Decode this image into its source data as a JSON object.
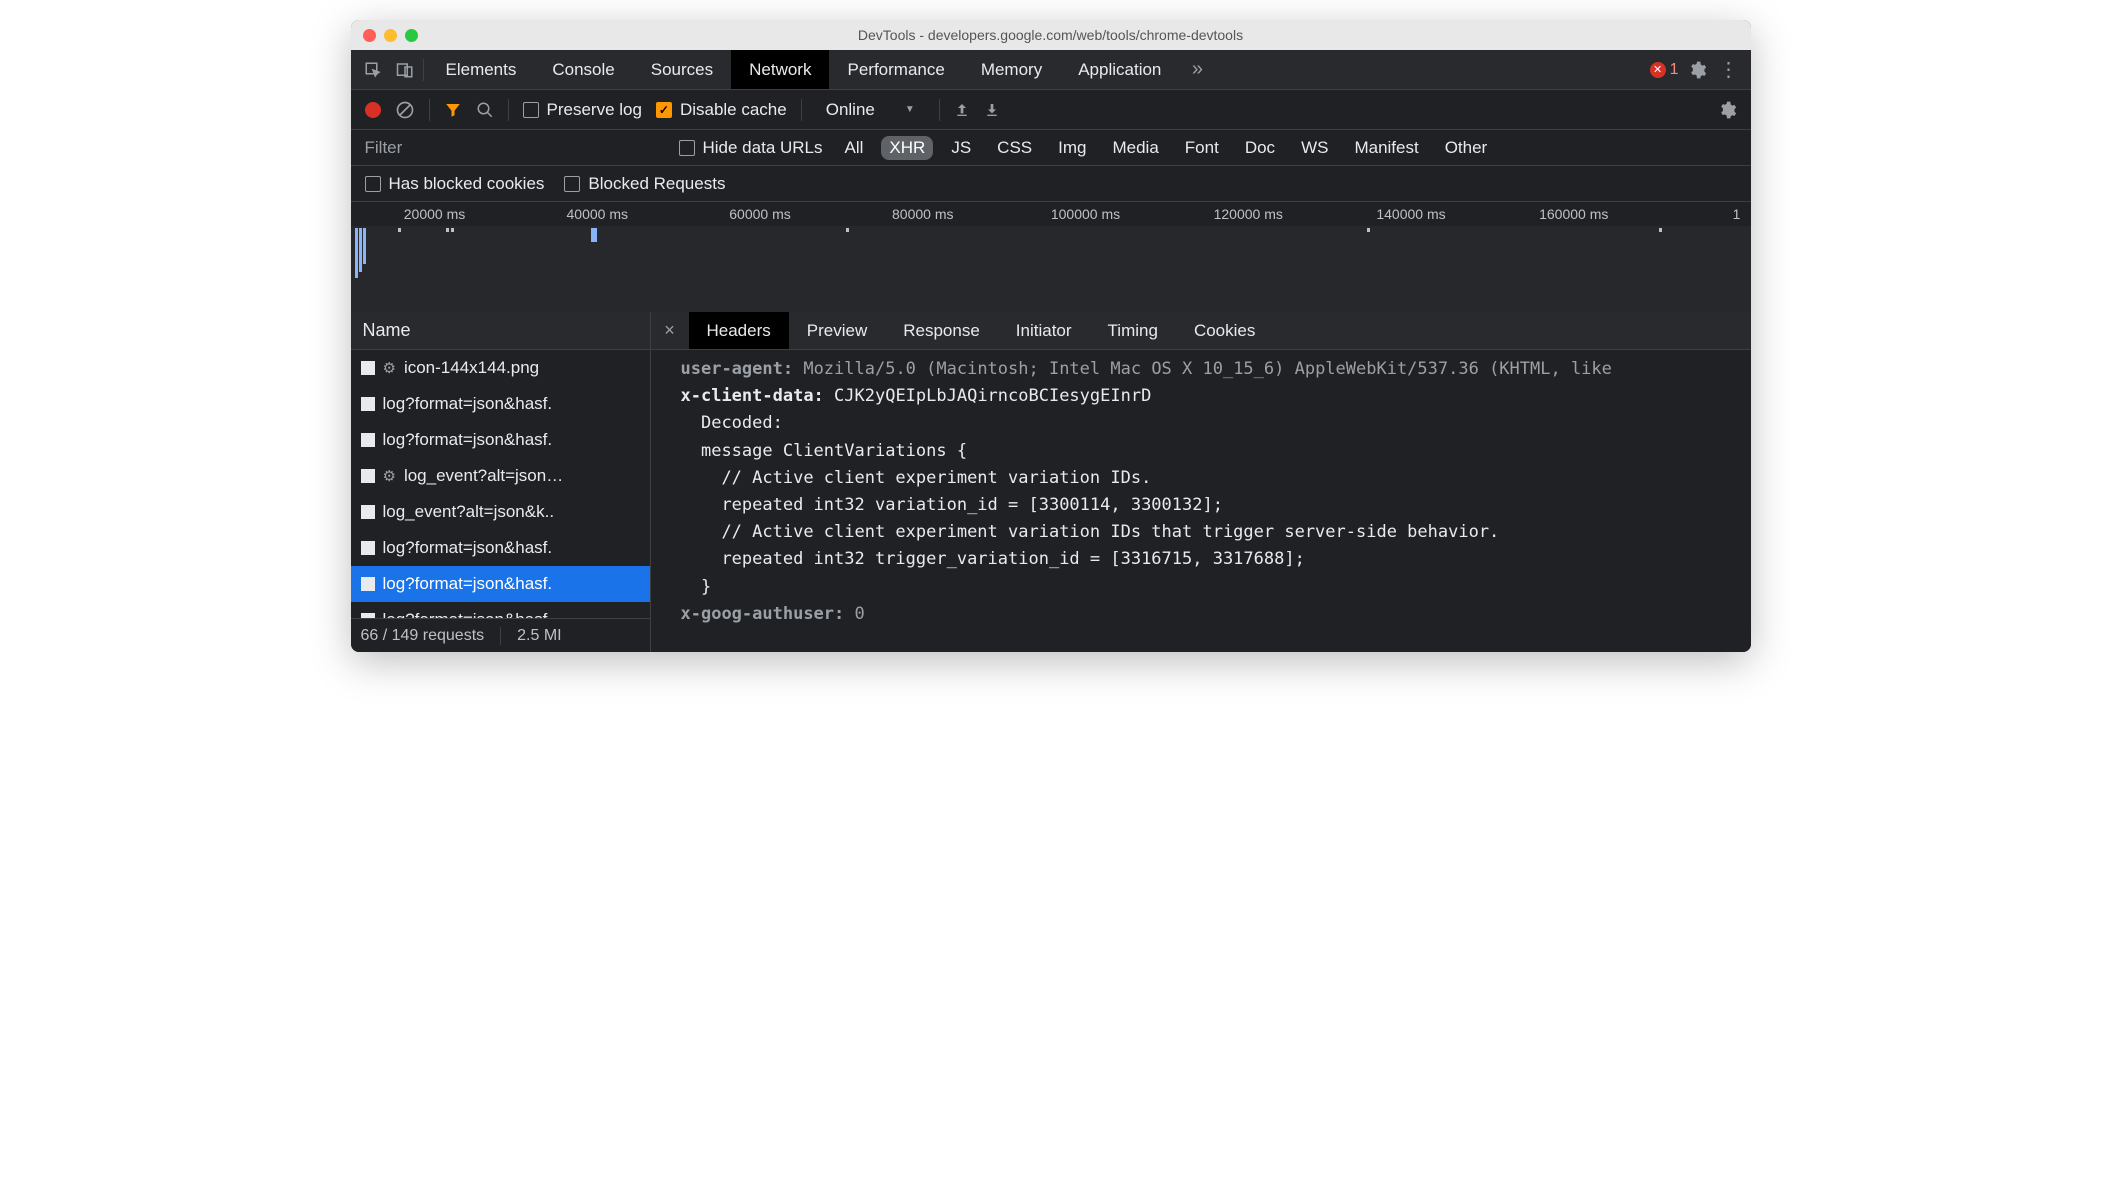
{
  "window": {
    "title": "DevTools - developers.google.com/web/tools/chrome-devtools"
  },
  "tabs": {
    "items": [
      "Elements",
      "Console",
      "Sources",
      "Network",
      "Performance",
      "Memory",
      "Application"
    ],
    "active": "Network",
    "error_count": "1"
  },
  "toolbar": {
    "preserve_log": "Preserve log",
    "disable_cache": "Disable cache",
    "throttling": "Online"
  },
  "filter": {
    "placeholder": "Filter",
    "hide_data_urls": "Hide data URLs",
    "types": [
      "All",
      "XHR",
      "JS",
      "CSS",
      "Img",
      "Media",
      "Font",
      "Doc",
      "WS",
      "Manifest",
      "Other"
    ],
    "active_type": "XHR",
    "has_blocked_cookies": "Has blocked cookies",
    "blocked_requests": "Blocked Requests"
  },
  "timeline": {
    "ticks": [
      "20000 ms",
      "40000 ms",
      "60000 ms",
      "80000 ms",
      "100000 ms",
      "120000 ms",
      "140000 ms",
      "160000 ms",
      "1"
    ]
  },
  "requests": {
    "header": "Name",
    "items": [
      {
        "name": "icon-144x144.png",
        "gear": true
      },
      {
        "name": "log?format=json&hasf.",
        "gear": false
      },
      {
        "name": "log?format=json&hasf.",
        "gear": false
      },
      {
        "name": "log_event?alt=json…",
        "gear": true
      },
      {
        "name": "log_event?alt=json&k..",
        "gear": false
      },
      {
        "name": "log?format=json&hasf.",
        "gear": false
      },
      {
        "name": "log?format=json&hasf.",
        "gear": false,
        "selected": true
      },
      {
        "name": "log?format=json&hasf.",
        "gear": false
      }
    ],
    "footer_left": "66 / 149 requests",
    "footer_right": "2.5 MI"
  },
  "detail": {
    "tabs": [
      "Headers",
      "Preview",
      "Response",
      "Initiator",
      "Timing",
      "Cookies"
    ],
    "active": "Headers",
    "lines": [
      {
        "k": "user-agent:",
        "v": " Mozilla/5.0 (Macintosh; Intel Mac OS X 10_15_6) AppleWebKit/537.36 (KHTML, like",
        "muted": true
      },
      {
        "k": "x-client-data:",
        "v": " CJK2yQEIpLbJAQirncoBCIesygEInrD"
      },
      {
        "plain": "  Decoded:"
      },
      {
        "plain": "  message ClientVariations {"
      },
      {
        "plain": "    // Active client experiment variation IDs."
      },
      {
        "plain": "    repeated int32 variation_id = [3300114, 3300132];"
      },
      {
        "plain": ""
      },
      {
        "plain": "    // Active client experiment variation IDs that trigger server-side behavior."
      },
      {
        "plain": "    repeated int32 trigger_variation_id = [3316715, 3317688];"
      },
      {
        "plain": "  }"
      },
      {
        "k": "x-goog-authuser:",
        "v": " 0",
        "muted": true
      }
    ]
  }
}
